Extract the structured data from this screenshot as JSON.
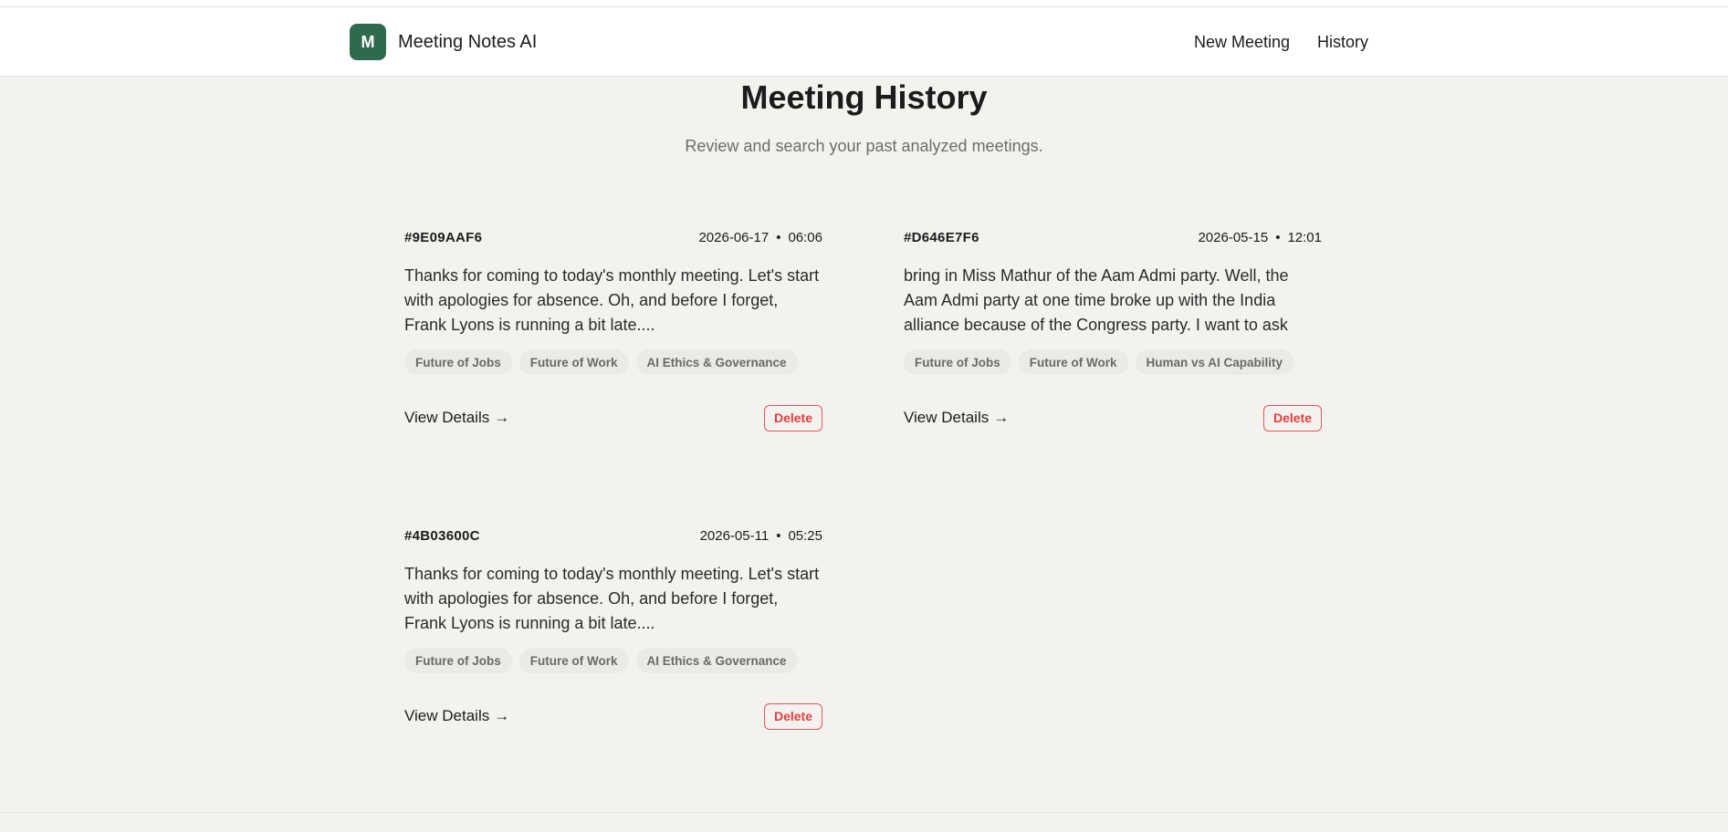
{
  "app": {
    "logo_letter": "M",
    "title": "Meeting Notes AI"
  },
  "nav": {
    "new_meeting": "New Meeting",
    "history": "History"
  },
  "page": {
    "title": "Meeting History",
    "subtitle": "Review and search your past analyzed meetings."
  },
  "meetings": [
    {
      "id": "#9E09AAF6",
      "date": "2026-06-17",
      "separator": "•",
      "time": "06:06",
      "excerpt": "Thanks for coming to today's monthly meeting. Let's start with apologies for absence. Oh, and before I forget, Frank Lyons is running a bit late....",
      "tags": [
        "Future of Jobs",
        "Future of Work",
        "AI Ethics & Governance"
      ],
      "view_label": "View Details",
      "arrow": "→",
      "delete_label": "Delete"
    },
    {
      "id": "#D646E7F6",
      "date": "2026-05-15",
      "separator": "•",
      "time": "12:01",
      "excerpt": "bring in Miss Mathur of the Aam Admi party. Well, the Aam Admi party at one time broke up with the India alliance because of the Congress party. I want to ask yo...",
      "tags": [
        "Future of Jobs",
        "Future of Work",
        "Human vs AI Capability"
      ],
      "view_label": "View Details",
      "arrow": "→",
      "delete_label": "Delete"
    },
    {
      "id": "#4B03600C",
      "date": "2026-05-11",
      "separator": "•",
      "time": "05:25",
      "excerpt": "Thanks for coming to today's monthly meeting. Let's start with apologies for absence. Oh, and before I forget, Frank Lyons is running a bit late....",
      "tags": [
        "Future of Jobs",
        "Future of Work",
        "AI Ethics & Governance"
      ],
      "view_label": "View Details",
      "arrow": "→",
      "delete_label": "Delete"
    }
  ],
  "colors": {
    "brand": "#2f6a4d",
    "background": "#f3f2ef",
    "delete": "#e53e3e"
  }
}
